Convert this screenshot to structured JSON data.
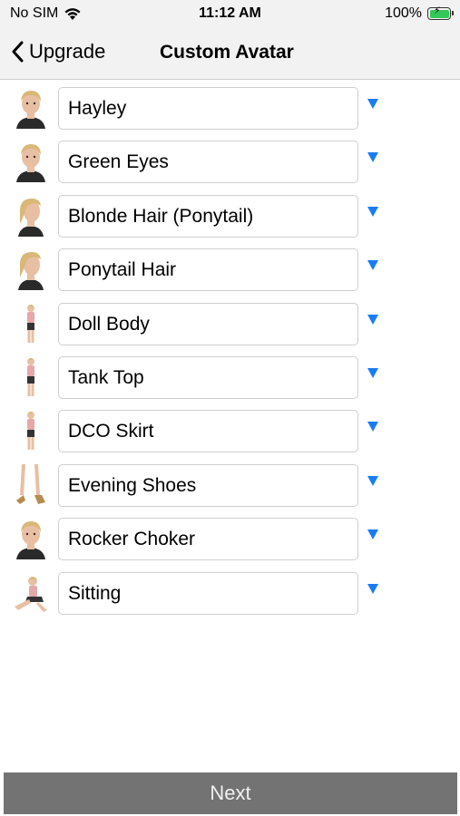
{
  "status_bar": {
    "carrier": "No SIM",
    "time": "11:12 AM",
    "battery": "100%",
    "battery_color": "#34c759"
  },
  "nav": {
    "back_label": "Upgrade",
    "title": "Custom Avatar"
  },
  "items": [
    {
      "label": "Hayley",
      "thumb": "avatar-head"
    },
    {
      "label": "Green Eyes",
      "thumb": "avatar-head"
    },
    {
      "label": "Blonde Hair (Ponytail)",
      "thumb": "avatar-head-side"
    },
    {
      "label": "Ponytail Hair",
      "thumb": "avatar-head-side"
    },
    {
      "label": "Doll Body",
      "thumb": "full-body"
    },
    {
      "label": "Tank Top",
      "thumb": "full-body"
    },
    {
      "label": "DCO Skirt",
      "thumb": "full-body"
    },
    {
      "label": "Evening Shoes",
      "thumb": "legs-shoes"
    },
    {
      "label": "Rocker Choker",
      "thumb": "avatar-head"
    },
    {
      "label": "Sitting",
      "thumb": "sitting-pose"
    }
  ],
  "accent_color": "#1a7cf5",
  "next_label": "Next"
}
